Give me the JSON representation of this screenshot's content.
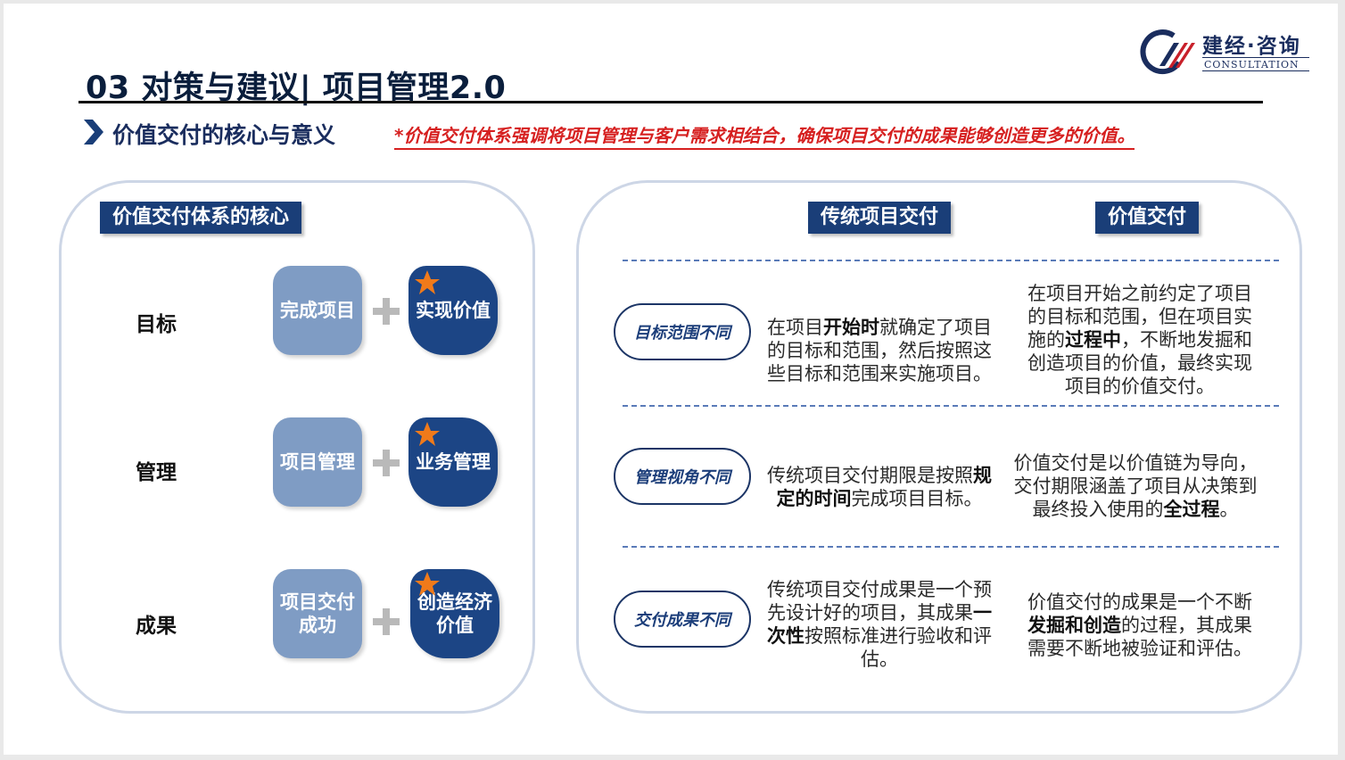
{
  "header": {
    "title": "03 对策与建议| 项目管理2.0",
    "logo_cn": "建经·咨询",
    "logo_en": "CONSULTATION",
    "subtitle": "价值交付的核心与意义",
    "note": "*价值交付体系强调将项目管理与客户需求相结合，确保项目交付的成果能够创造更多的价值。"
  },
  "left_panel": {
    "tag": "价值交付体系的核心",
    "rows": [
      {
        "label": "目标",
        "base": "完成项目",
        "plus": "实现价值"
      },
      {
        "label": "管理",
        "base": "项目管理",
        "plus": "业务管理"
      },
      {
        "label": "成果",
        "base": "项目交付成功",
        "plus": "创造经济价值"
      }
    ]
  },
  "right_panel": {
    "col_traditional": "传统项目交付",
    "col_value": "价值交付",
    "rows": [
      {
        "aspect": "目标范围不同",
        "trad": {
          "a": "在项目",
          "b": "开始时",
          "c": "就确定了项目的目标和范围，然后按照这些目标和范围来实施项目。"
        },
        "value": {
          "a": "在项目开始之前约定了项目的目标和范围，但在项目实施的",
          "b": "过程中",
          "c": "，不断地发掘和创造项目的价值，最终实现项目的价值交付。"
        }
      },
      {
        "aspect": "管理视角不同",
        "trad": {
          "a": "传统项目交付期限是按照",
          "b": "规定的时间",
          "c": "完成项目目标。"
        },
        "value": {
          "a": "价值交付是以价值链为导向，交付期限涵盖了项目从决策到最终投入使用的",
          "b": "全过程",
          "c": "。"
        }
      },
      {
        "aspect": "交付成果不同",
        "trad": {
          "a": "传统项目交付成果是一个预先设计好的项目，其成果",
          "b": "一次性",
          "c": "按照标准进行验收和评估。"
        },
        "value": {
          "a": "价值交付的成果是一个不断",
          "b": "发掘和创造",
          "c": "的过程，其成果需要不断地被验证和评估。"
        }
      }
    ]
  },
  "colors": {
    "navy": "#1a3e78",
    "light_blue": "#7f9cc4",
    "accent_red": "#d62020",
    "star_orange": "#f07a1a"
  },
  "icons": [
    "chevron-right-icon",
    "star-icon",
    "plus-icon",
    "logo-mark"
  ]
}
